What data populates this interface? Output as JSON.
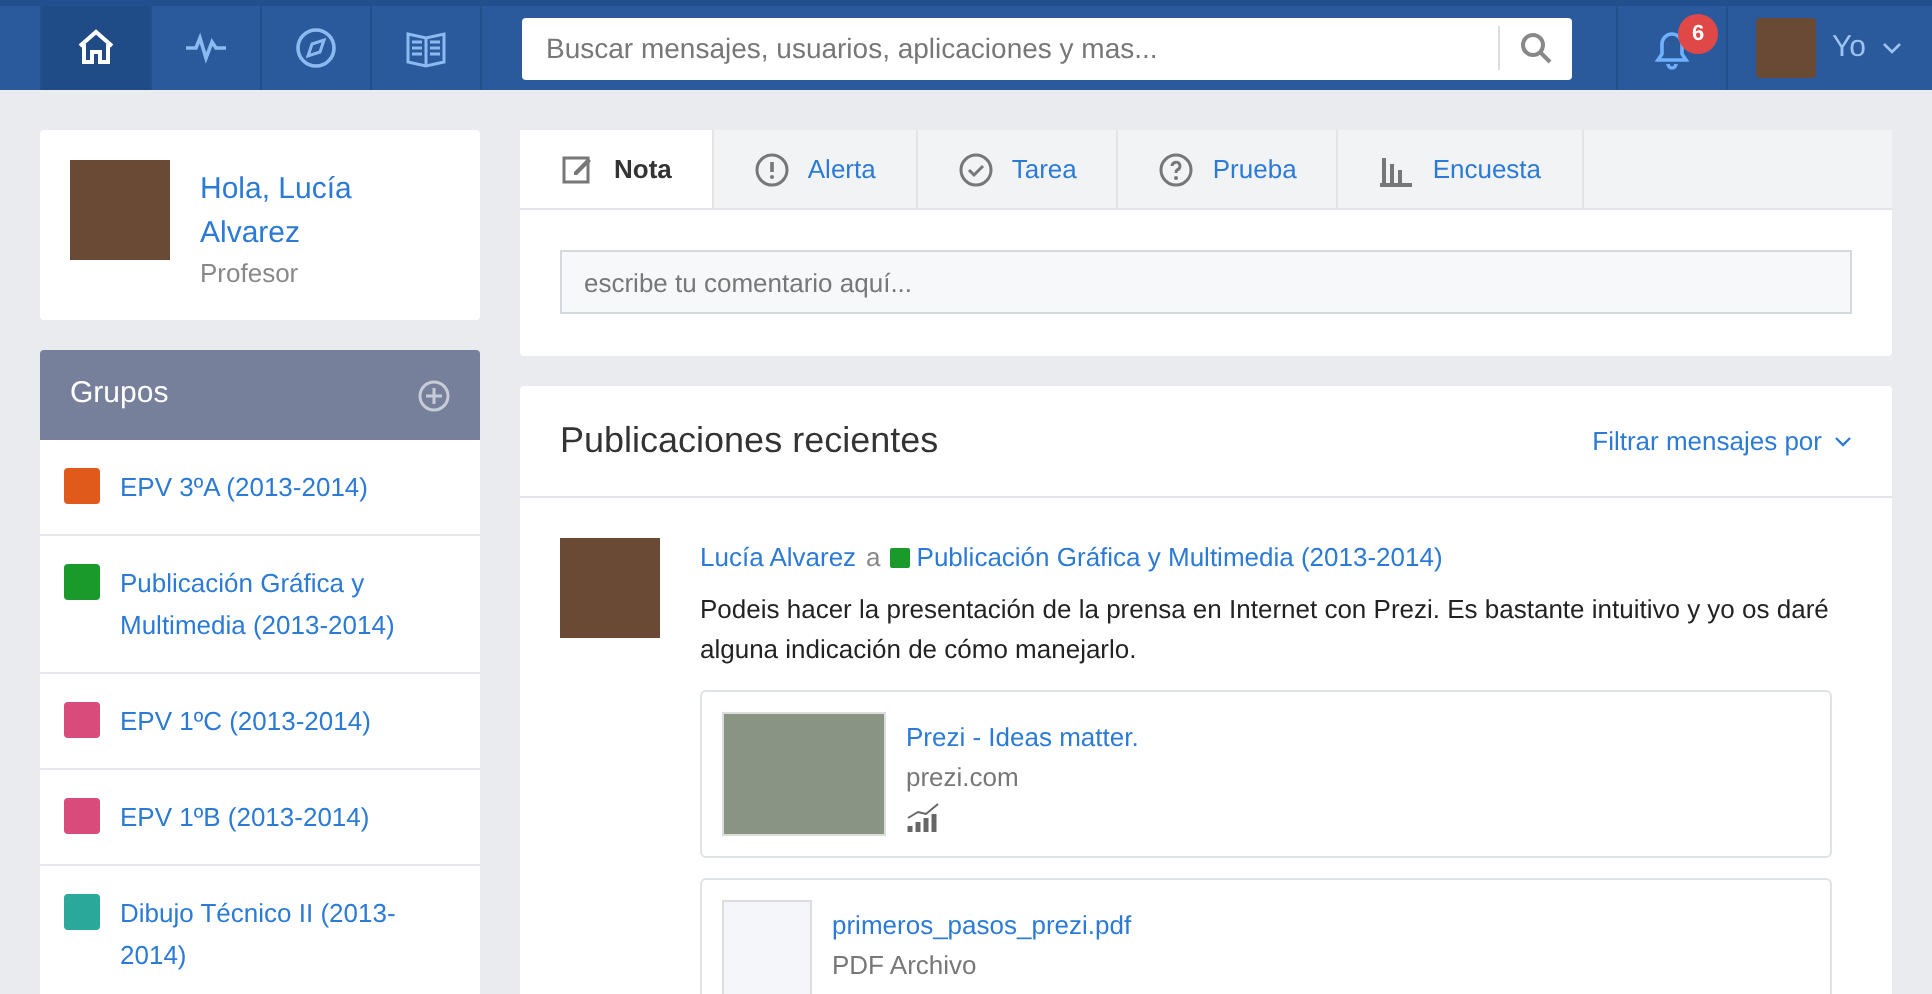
{
  "nav": {
    "tabs": [
      {
        "selected": true
      },
      {
        "selected": false
      },
      {
        "selected": false
      },
      {
        "selected": false
      }
    ],
    "search": {
      "placeholder": "Buscar mensajes, usuarios, aplicaciones y mas..."
    },
    "notifications": {
      "count": "6"
    },
    "user": {
      "label": "Yo"
    }
  },
  "profile": {
    "greeting": "Hola, Lucía Alvarez",
    "role": "Profesor"
  },
  "groups": {
    "title": "Grupos",
    "items": [
      {
        "name": "EPV 3ºA (2013-2014)",
        "color": "#e05a1c"
      },
      {
        "name": "Publicación Gráfica y Multimedia (2013-2014)",
        "color": "#1a9a2b"
      },
      {
        "name": "EPV 1ºC (2013-2014)",
        "color": "#d94b7a"
      },
      {
        "name": "EPV 1ºB (2013-2014)",
        "color": "#d94b7a"
      },
      {
        "name": "Dibujo Técnico II (2013-2014)",
        "color": "#2aa89a"
      }
    ]
  },
  "composer": {
    "tabs": [
      {
        "label": "Nota",
        "selected": true
      },
      {
        "label": "Alerta",
        "selected": false
      },
      {
        "label": "Tarea",
        "selected": false
      },
      {
        "label": "Prueba",
        "selected": false
      },
      {
        "label": "Encuesta",
        "selected": false
      }
    ],
    "placeholder": "escribe tu comentario aquí..."
  },
  "feed": {
    "title": "Publicaciones recientes",
    "filter": "Filtrar mensajes por",
    "posts": [
      {
        "author": "Lucía Alvarez",
        "connector": "a",
        "group": {
          "name": "Publicación Gráfica y Multimedia (2013-2014)",
          "color": "#1a9a2b"
        },
        "text": "Podeis hacer la presentación de la prensa en Internet con Prezi. Es bastante intuitivo y yo os daré alguna indicación de cómo manejarlo.",
        "attachments": [
          {
            "kind": "link",
            "title": "Prezi - Ideas matter.",
            "subtitle": "prezi.com"
          },
          {
            "kind": "pdf",
            "title": "primeros_pasos_prezi.pdf",
            "subtitle": "PDF Archivo"
          }
        ]
      }
    ]
  }
}
